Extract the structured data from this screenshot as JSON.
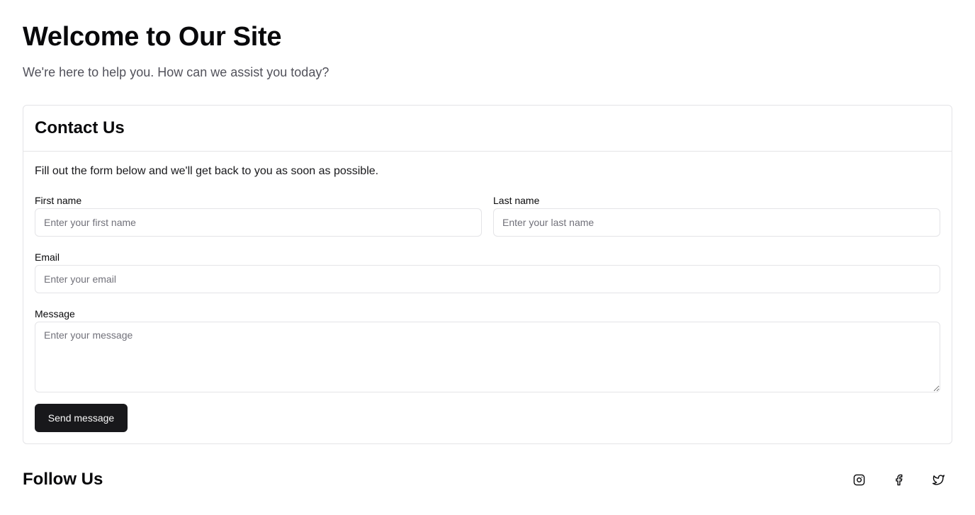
{
  "hero": {
    "title": "Welcome to Our Site",
    "subtitle": "We're here to help you. How can we assist you today?"
  },
  "contact": {
    "title": "Contact Us",
    "description": "Fill out the form below and we'll get back to you as soon as possible.",
    "fields": {
      "first_name": {
        "label": "First name",
        "placeholder": "Enter your first name",
        "value": ""
      },
      "last_name": {
        "label": "Last name",
        "placeholder": "Enter your last name",
        "value": ""
      },
      "email": {
        "label": "Email",
        "placeholder": "Enter your email",
        "value": ""
      },
      "message": {
        "label": "Message",
        "placeholder": "Enter your message",
        "value": ""
      }
    },
    "submit_label": "Send message"
  },
  "follow": {
    "title": "Follow Us",
    "icons": [
      "instagram-icon",
      "facebook-icon",
      "twitter-icon"
    ]
  },
  "colors": {
    "primary_button": "#18181b",
    "border": "#e4e4e7",
    "muted_text": "#52525b"
  }
}
